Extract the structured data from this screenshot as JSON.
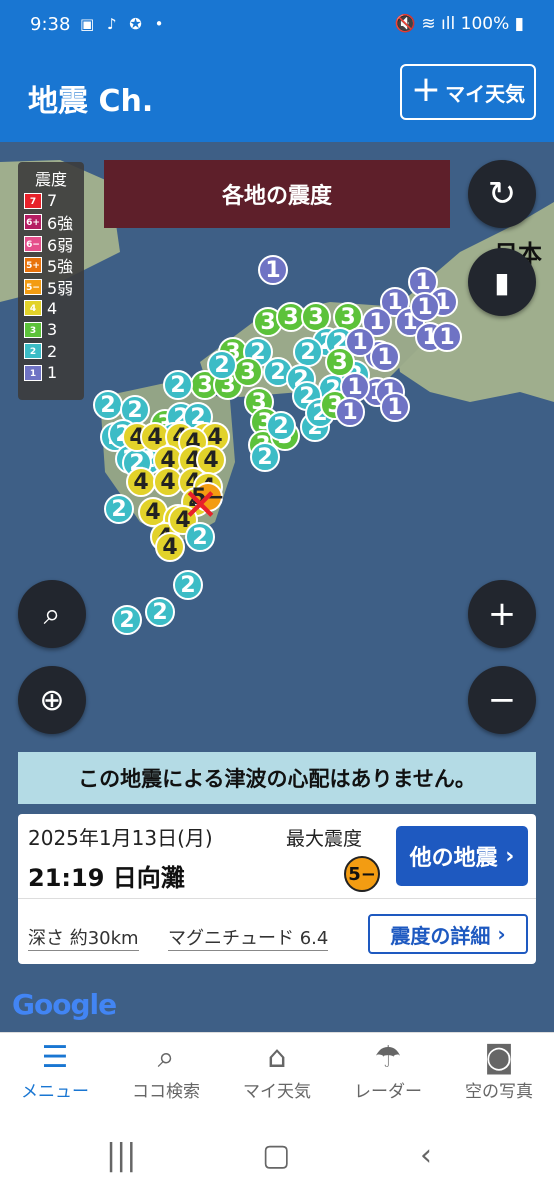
{
  "status": {
    "time": "9:38",
    "battery": "100%",
    "icons": "▣ ♪ ✪ •",
    "right_icons": "🔇 ≋ ıll"
  },
  "appbar": {
    "title": "地震 Ch.",
    "my_weather_plus": "+",
    "my_weather_label": "マイ天気"
  },
  "map": {
    "banner": "各地の震度",
    "region_label": "日本",
    "legend": {
      "title": "震度",
      "items": [
        {
          "code": "7",
          "label": "7",
          "color": "#e8212a"
        },
        {
          "code": "6+",
          "label": "6強",
          "color": "#b51e63"
        },
        {
          "code": "6−",
          "label": "6弱",
          "color": "#e54f8b"
        },
        {
          "code": "5+",
          "label": "5強",
          "color": "#e8730c"
        },
        {
          "code": "5−",
          "label": "5弱",
          "color": "#f39c12"
        },
        {
          "code": "4",
          "label": "4",
          "color": "#e2d22a"
        },
        {
          "code": "3",
          "label": "3",
          "color": "#5cc23a"
        },
        {
          "code": "2",
          "label": "2",
          "color": "#3cbcc6"
        },
        {
          "code": "1",
          "label": "1",
          "color": "#6f73c4"
        }
      ]
    },
    "epicenter": "✕"
  },
  "intensities": [
    "1",
    "1",
    "1",
    "1",
    "1",
    "1",
    "1",
    "1",
    "1",
    "1",
    "3",
    "3",
    "3",
    "2",
    "3",
    "3",
    "2",
    "2",
    "2",
    "1",
    "2",
    "3",
    "3",
    "2",
    "3",
    "2",
    "2",
    "2",
    "3",
    "3",
    "3",
    "3",
    "2",
    "2",
    "2",
    "2",
    "2",
    "3",
    "2",
    "2",
    "2",
    "2",
    "2",
    "2",
    "3",
    "2",
    "2",
    "2",
    "2",
    "4",
    "4",
    "4",
    "4",
    "4",
    "4",
    "4",
    "4",
    "4",
    "4",
    "4",
    "4",
    "4",
    "4",
    "4",
    "4",
    "4",
    "4",
    "4",
    "5−",
    "2",
    "2",
    "2",
    "2",
    "1",
    "1",
    "1",
    "1",
    "1",
    "1",
    "3",
    "2",
    "2"
  ],
  "tsunami": "この地震による津波の心配はありません。",
  "quake": {
    "date": "2025年1月13日(月)",
    "time_location": "21:19 日向灘",
    "max_label": "最大震度",
    "max_value": "5−",
    "other_button": "他の地震",
    "depth": "深さ 約30km",
    "magnitude": "マグニチュード 6.4",
    "detail_button": "震度の詳細"
  },
  "google_logo": "Google",
  "nav": [
    {
      "label": "メニュー",
      "icon": "menu-icon"
    },
    {
      "label": "ココ検索",
      "icon": "search-icon"
    },
    {
      "label": "マイ天気",
      "icon": "home-icon"
    },
    {
      "label": "レーダー",
      "icon": "umbrella-icon"
    },
    {
      "label": "空の写真",
      "icon": "camera-icon"
    }
  ],
  "colors": {
    "primary": "#1976d2",
    "banner": "#5e1f2a",
    "tsunami_bg": "#b4dbe5",
    "button": "#1e59c0",
    "sea": "#3e5f86",
    "land": "#9fae8d"
  }
}
